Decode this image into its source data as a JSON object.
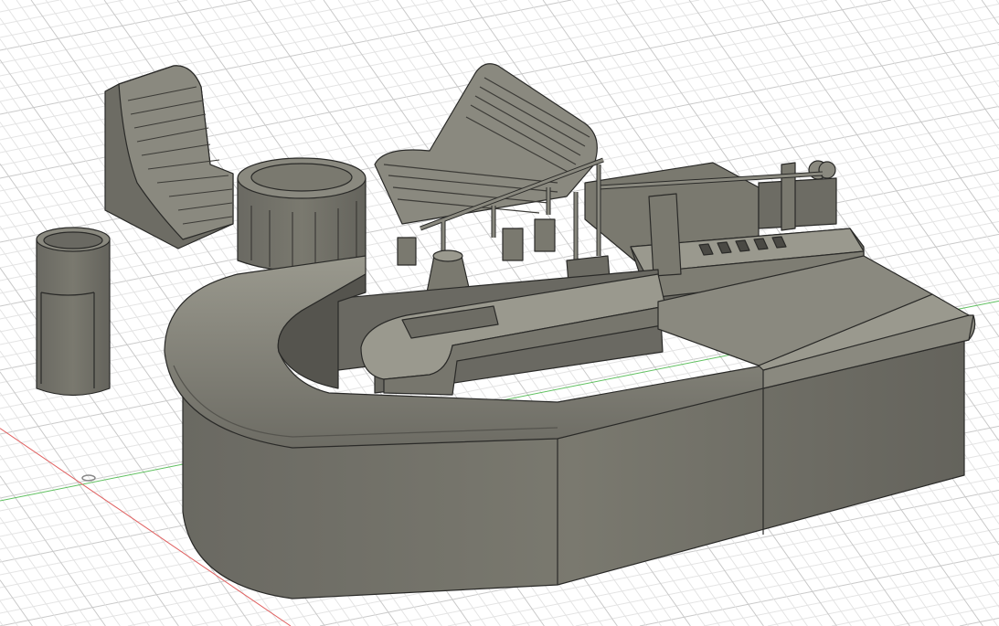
{
  "viewport": {
    "background": "#ffffff",
    "grid_minor_color": "#e4e4e4",
    "grid_major_color": "#c9c9c9",
    "x_axis_color": "#e06060",
    "y_axis_color": "#60c060"
  },
  "model": {
    "body_color": "#6e6d66",
    "body_light": "#8a897f",
    "body_dark": "#55544e",
    "edge_color": "#2a2a28"
  },
  "icons": [
    "origin-icon"
  ]
}
